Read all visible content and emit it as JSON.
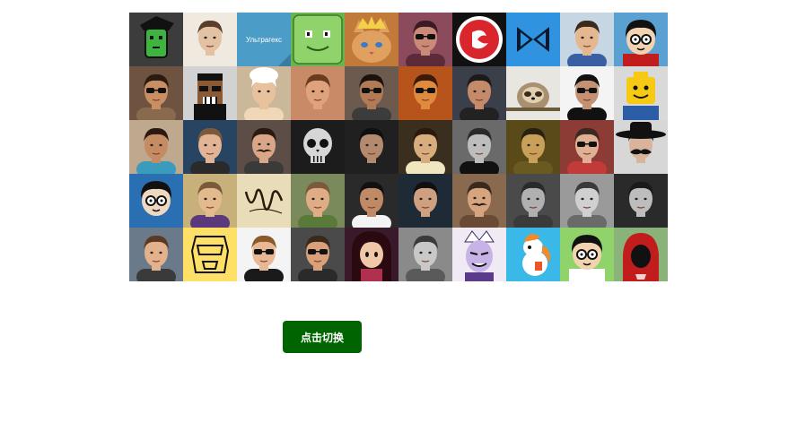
{
  "avatars": [
    {
      "label": "",
      "bg": "#3c3c3c",
      "skin": "#3fb33f",
      "hair": "#1a1a1a",
      "shirt": "#2b2b2b",
      "style": "mono",
      "icon": "green-cartoon-avatar-icon"
    },
    {
      "label": "",
      "bg": "#efe9df",
      "skin": "#e3c2a4",
      "hair": "#5a3d2b",
      "shirt": "#efe9df",
      "style": "photo",
      "icon": "person-photo-icon"
    },
    {
      "label": "Ультрагекс",
      "bg": "#4b9cc7",
      "style": "text",
      "icon": "text-logo-icon"
    },
    {
      "label": "",
      "bg": "#68b54d",
      "style": "smile",
      "icon": "green-smiley-icon"
    },
    {
      "label": "",
      "bg": "#c27a3a",
      "skin": "#d89a5a",
      "hair": "#6b3f1a",
      "shirt": "#3557a8",
      "style": "cat",
      "icon": "cat-king-icon"
    },
    {
      "label": "",
      "bg": "#8b4b5c",
      "skin": "#c98a77",
      "hair": "#3b1a22",
      "shirt": "#5c2a38",
      "style": "glasses",
      "icon": "person-sunglasses-icon"
    },
    {
      "label": "",
      "bg": "#111111",
      "style": "logo",
      "icon": "red-circle-logo-icon"
    },
    {
      "label": "",
      "bg": "#2f93e0",
      "style": "bowtie",
      "icon": "bowtie-logo-icon"
    },
    {
      "label": "",
      "bg": "#c7d6e3",
      "skin": "#e4b78f",
      "hair": "#3b2a1d",
      "shirt": "#3b5fa3",
      "style": "photo",
      "icon": "person-photo-icon"
    },
    {
      "label": "",
      "bg": "#5aa0d0",
      "skin": "#f2d3b0",
      "hair": "#111111",
      "shirt": "#c21d1d",
      "style": "cartoon",
      "icon": "cartoon-glasses-icon"
    },
    {
      "label": "",
      "bg": "#6e5440",
      "skin": "#c98e62",
      "hair": "#2a1b12",
      "shirt": "#8a6a4f",
      "style": "glasses",
      "icon": "person-sunglasses-icon"
    },
    {
      "label": "",
      "bg": "#d2d2d2",
      "skin": "#8a5a34",
      "hair": "#111111",
      "shirt": "#111111",
      "style": "pixel",
      "icon": "pixel-avatar-icon"
    },
    {
      "label": "",
      "bg": "#cbb89a",
      "skin": "#e7c29c",
      "hair": "#ffffff",
      "shirt": "#f0d7b7",
      "style": "chef",
      "icon": "chef-hat-icon"
    },
    {
      "label": "",
      "bg": "#c98a68",
      "skin": "#e0a27d",
      "hair": "#6a3b1e",
      "shirt": "#c98a68",
      "style": "photo",
      "icon": "person-photo-icon"
    },
    {
      "label": "",
      "bg": "#6d5a4e",
      "skin": "#b27a55",
      "hair": "#1a120d",
      "shirt": "#3c3c3c",
      "style": "glasses",
      "icon": "person-sunglasses-icon"
    },
    {
      "label": "",
      "bg": "#b6541c",
      "skin": "#e08a3e",
      "hair": "#3b1a08",
      "shirt": "#b6541c",
      "style": "glasses",
      "icon": "person-glasses-icon"
    },
    {
      "label": "",
      "bg": "#3a3f4a",
      "skin": "#c48a6a",
      "hair": "#1b1b1b",
      "shirt": "#222222",
      "style": "photo",
      "icon": "person-photo-icon"
    },
    {
      "label": "",
      "bg": "#e8e6e0",
      "skin": "#8a7a5a",
      "hair": "#5a4a30",
      "shirt": "#e8e6e0",
      "style": "sloth",
      "icon": "sloth-icon"
    },
    {
      "label": "",
      "bg": "#f4f4f4",
      "skin": "#c49272",
      "hair": "#111111",
      "shirt": "#111111",
      "style": "glasses",
      "icon": "person-sunglasses-icon"
    },
    {
      "label": "",
      "bg": "#d9d9d9",
      "skin": "#f6c915",
      "hair": "#111111",
      "shirt": "#2c5ea8",
      "style": "lego",
      "icon": "lego-head-icon"
    },
    {
      "label": "",
      "bg": "#bfa98e",
      "skin": "#c58b62",
      "hair": "#2c1a10",
      "shirt": "#3a9bbd",
      "style": "photo",
      "icon": "person-photo-icon"
    },
    {
      "label": "",
      "bg": "#274463",
      "skin": "#e2b394",
      "hair": "#7a5a3a",
      "shirt": "#2a2a2a",
      "style": "photo",
      "icon": "person-photo-icon"
    },
    {
      "label": "",
      "bg": "#5c4e46",
      "skin": "#d9a788",
      "hair": "#2a1a12",
      "shirt": "#3a3a3a",
      "style": "mustache",
      "icon": "person-mustache-icon"
    },
    {
      "label": "",
      "bg": "#1c1c1c",
      "skin": "#8c8c8c",
      "hair": "#1c1c1c",
      "shirt": "#1c1c1c",
      "style": "skull",
      "icon": "skull-icon"
    },
    {
      "label": "",
      "bg": "#202020",
      "skin": "#b38a6e",
      "hair": "#0f0f0f",
      "shirt": "#202020",
      "style": "photo",
      "icon": "person-photo-icon"
    },
    {
      "label": "",
      "bg": "#3a2f1e",
      "skin": "#d8ad7e",
      "hair": "#2a1a0e",
      "shirt": "#f0e6c0",
      "style": "photo",
      "icon": "person-photo-icon"
    },
    {
      "label": "",
      "bg": "#6a6a6a",
      "skin": "#bdbdbd",
      "hair": "#2a2a2a",
      "shirt": "#111111",
      "style": "photo",
      "icon": "person-photo-icon"
    },
    {
      "label": "",
      "bg": "#5a4a1a",
      "skin": "#c9a05a",
      "hair": "#2a2210",
      "shirt": "#6a5a20",
      "style": "photo",
      "icon": "person-photo-icon"
    },
    {
      "label": "",
      "bg": "#8c3b35",
      "skin": "#e0b094",
      "hair": "#3a2a22",
      "shirt": "#c23a3a",
      "style": "glasses",
      "icon": "person-glasses-icon"
    },
    {
      "label": "",
      "bg": "#d7d7d7",
      "skin": "#d9b49a",
      "hair": "#111111",
      "shirt": "#d7d7d7",
      "style": "hat",
      "icon": "cowboy-mustache-icon"
    },
    {
      "label": "",
      "bg": "#2b6fb3",
      "skin": "#f0d7c0",
      "hair": "#111111",
      "shirt": "#2b6fb3",
      "style": "cartoon",
      "icon": "bearded-cartoon-icon"
    },
    {
      "label": "",
      "bg": "#c7b07a",
      "skin": "#e3b98e",
      "hair": "#7a5a3a",
      "shirt": "#5a3a7a",
      "style": "photo",
      "icon": "person-photo-icon"
    },
    {
      "label": "",
      "bg": "#e9dcb8",
      "style": "script",
      "icon": "calligraphy-logo-icon"
    },
    {
      "label": "",
      "bg": "#7a8a5a",
      "skin": "#e0ac86",
      "hair": "#7a5a3a",
      "shirt": "#5a7a3a",
      "style": "photo",
      "icon": "person-photo-icon"
    },
    {
      "label": "",
      "bg": "#2a2a2a",
      "skin": "#c08a66",
      "hair": "#111111",
      "shirt": "#f4f4f4",
      "style": "photo",
      "icon": "person-photo-icon"
    },
    {
      "label": "",
      "bg": "#1e2a36",
      "skin": "#cfa080",
      "hair": "#101010",
      "shirt": "#1e2a36",
      "style": "photo",
      "icon": "person-photo-icon"
    },
    {
      "label": "",
      "bg": "#8a6a4e",
      "skin": "#d6a47e",
      "hair": "#3a2a1e",
      "shirt": "#6a4a34",
      "style": "mustache",
      "icon": "person-mustache-icon"
    },
    {
      "label": "",
      "bg": "#4a4a4a",
      "skin": "#b0b0b0",
      "hair": "#2a2a2a",
      "shirt": "#3a3a3a",
      "style": "photo",
      "icon": "person-photo-icon"
    },
    {
      "label": "",
      "bg": "#9a9a9a",
      "skin": "#d0d0d0",
      "hair": "#3a3a3a",
      "shirt": "#6a6a6a",
      "style": "photo",
      "icon": "person-photo-icon"
    },
    {
      "label": "",
      "bg": "#2a2a2a",
      "skin": "#bdbdbd",
      "hair": "#1a1a1a",
      "shirt": "#2a2a2a",
      "style": "photo",
      "icon": "person-photo-icon"
    },
    {
      "label": "",
      "bg": "#6a7a8a",
      "skin": "#e3b18c",
      "hair": "#5a3a22",
      "shirt": "#3a3a3a",
      "style": "photo",
      "icon": "person-photo-icon"
    },
    {
      "label": "",
      "bg": "#ffe066",
      "style": "robot",
      "icon": "robot-head-icon"
    },
    {
      "label": "",
      "bg": "#f4f4f4",
      "skin": "#e8b894",
      "hair": "#8a5a2a",
      "shirt": "#1a1a1a",
      "style": "glasses",
      "icon": "person-glasses-icon"
    },
    {
      "label": "",
      "bg": "#4a4a4a",
      "skin": "#d9a07a",
      "hair": "#3a2a1e",
      "shirt": "#2a2a2a",
      "style": "glasses",
      "icon": "person-glasses-icon"
    },
    {
      "label": "",
      "bg": "#3a1a2a",
      "skin": "#f0c8a8",
      "hair": "#2a0a10",
      "shirt": "#b03050",
      "style": "anime",
      "icon": "anime-girl-icon"
    },
    {
      "label": "",
      "bg": "#8a8a8a",
      "skin": "#c8c8c8",
      "hair": "#3a3a3a",
      "shirt": "#5a5a5a",
      "style": "photo",
      "icon": "person-photo-icon"
    },
    {
      "label": "",
      "bg": "#f0eaf5",
      "skin": "#c7b3e6",
      "hair": "#ffffff",
      "shirt": "#5a3a8a",
      "style": "villain",
      "icon": "cartoon-villain-icon"
    },
    {
      "label": "",
      "bg": "#3ab8e8",
      "style": "pony",
      "icon": "pony-icon"
    },
    {
      "label": "",
      "bg": "#8fd36a",
      "skin": "#f2d3b0",
      "hair": "#111111",
      "shirt": "#ffffff",
      "style": "cartoon",
      "icon": "cartoon-glasses-icon"
    },
    {
      "label": "",
      "bg": "#8ab37a",
      "skin": "#1a1a1a",
      "hair": "#c21d1d",
      "shirt": "#c21d1d",
      "style": "hood",
      "icon": "red-hoodie-icon"
    }
  ],
  "toggle_button": {
    "label": "点击切换",
    "color": "#006400"
  }
}
